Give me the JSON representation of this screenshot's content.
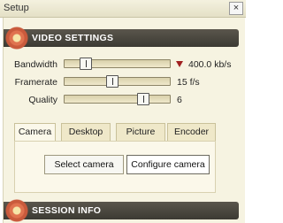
{
  "window": {
    "title": "Setup",
    "close_glyph": "×"
  },
  "video": {
    "header": "VIDEO SETTINGS",
    "rows": [
      {
        "label": "Bandwidth",
        "value": "400.0 kb/s",
        "level": 0.16
      },
      {
        "label": "Framerate",
        "value": "15 f/s",
        "level": 0.45
      },
      {
        "label": "Quality",
        "value": "6",
        "level": 0.78
      }
    ],
    "bandwidth_indicator_color": "#a02020"
  },
  "tabs": [
    {
      "label": "Camera",
      "active": true
    },
    {
      "label": "Desktop",
      "active": false
    },
    {
      "label": "Picture",
      "active": false
    },
    {
      "label": "Encoder",
      "active": false
    }
  ],
  "camera": {
    "select_label": "Select camera",
    "configure_label": "Configure camera"
  },
  "session": {
    "header": "SESSION INFO"
  },
  "colors": {
    "header_bg": "#4a4740",
    "panel_bg": "#f6f3e1",
    "accent": "#c95a3c"
  },
  "icons": {
    "section_icon": "flower-icon",
    "close": "close-icon",
    "indicator": "triangle-down-icon"
  }
}
